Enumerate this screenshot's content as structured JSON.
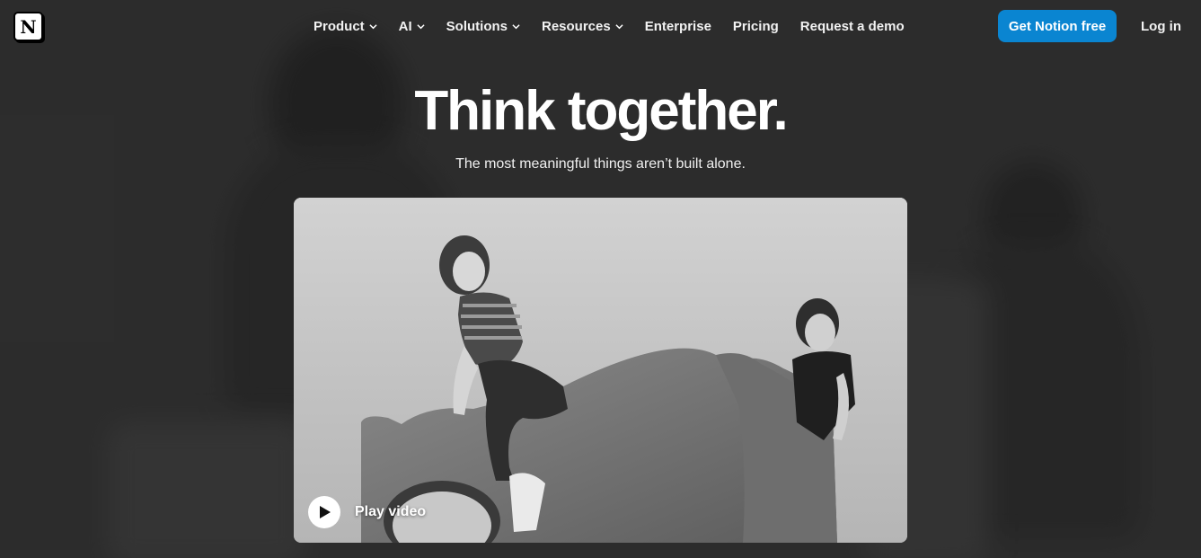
{
  "brand": {
    "logo_letter": "N",
    "logo_icon": "notion-logo-icon"
  },
  "nav": {
    "items": [
      {
        "label": "Product",
        "has_dropdown": true
      },
      {
        "label": "AI",
        "has_dropdown": true
      },
      {
        "label": "Solutions",
        "has_dropdown": true
      },
      {
        "label": "Resources",
        "has_dropdown": true
      },
      {
        "label": "Enterprise",
        "has_dropdown": false
      },
      {
        "label": "Pricing",
        "has_dropdown": false
      },
      {
        "label": "Request a demo",
        "has_dropdown": false
      }
    ],
    "cta_label": "Get Notion free",
    "login_label": "Log in"
  },
  "hero": {
    "title": "Think together.",
    "subtitle": "The most meaningful things aren’t built alone."
  },
  "video": {
    "play_label": "Play video",
    "play_icon": "play-icon"
  },
  "colors": {
    "background": "#2f2f2f",
    "accent": "#0a85d1",
    "text": "#ffffff"
  }
}
